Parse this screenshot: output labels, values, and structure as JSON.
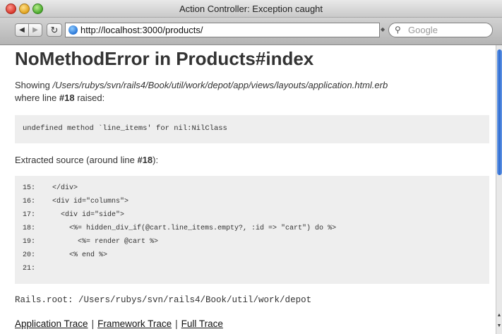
{
  "window": {
    "title": "Action Controller: Exception caught"
  },
  "toolbar": {
    "back_glyph": "◀",
    "forward_glyph": "▶",
    "reload_glyph": "↻",
    "url": "http://localhost:3000/products/",
    "search_placeholder": "Google"
  },
  "page": {
    "title": "NoMethodError in Products#index",
    "showing_prefix": "Showing ",
    "template_path": "/Users/rubys/svn/rails4/Book/util/work/depot/app/views/layouts/application.html.erb",
    "where_line_prefix": "where line ",
    "line_ref": "#18",
    "raised_suffix": " raised:",
    "error_message": "undefined method `line_items' for nil:NilClass",
    "extracted_prefix": "Extracted source (around line ",
    "extracted_line": "#18",
    "extracted_suffix": "):",
    "source_lines": [
      {
        "num": "15:",
        "code": "</div>"
      },
      {
        "num": "16:",
        "code": "<div id=\"columns\">"
      },
      {
        "num": "17:",
        "code": "  <div id=\"side\">"
      },
      {
        "num": "18:",
        "code": "    <%= hidden_div_if(@cart.line_items.empty?, :id => \"cart\") do %>"
      },
      {
        "num": "19:",
        "code": "      <%= render @cart %>"
      },
      {
        "num": "20:",
        "code": "    <% end %>"
      },
      {
        "num": "21:",
        "code": ""
      }
    ],
    "rails_root": "Rails.root: /Users/rubys/svn/rails4/Book/util/work/depot",
    "traces": {
      "application": "Application Trace",
      "framework": "Framework Trace",
      "full": "Full Trace",
      "separator": "|"
    }
  },
  "colors": {
    "scroll_thumb": "#2c6ad0",
    "code_bg": "#eeeeee"
  }
}
